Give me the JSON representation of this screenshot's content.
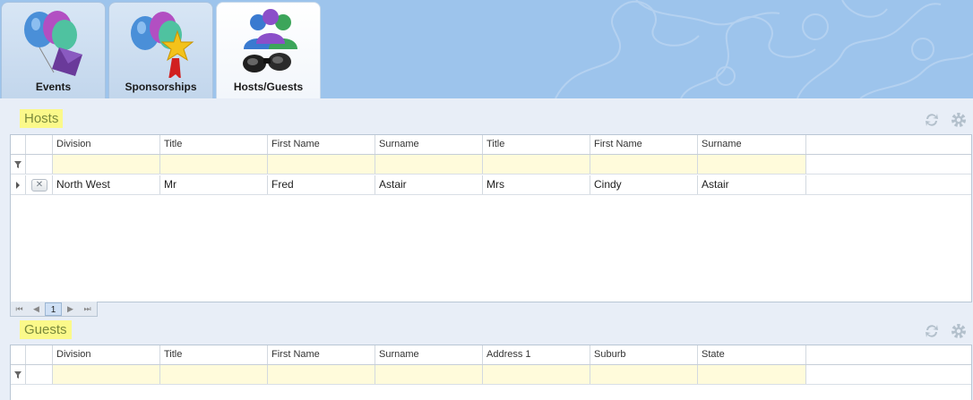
{
  "tabs": [
    {
      "label": "Events",
      "icon": "balloons-envelope-icon"
    },
    {
      "label": "Sponsorships",
      "icon": "balloons-award-icon"
    },
    {
      "label": "Hosts/Guests",
      "icon": "people-binoculars-icon",
      "active": true
    }
  ],
  "hosts": {
    "title": "Hosts",
    "columns": [
      "Division",
      "Title",
      "First Name",
      "Surname",
      "Title",
      "First Name",
      "Surname"
    ],
    "rows": [
      {
        "cells": [
          "North West",
          "Mr",
          "Fred",
          "Astair",
          "Mrs",
          "Cindy",
          "Astair"
        ]
      }
    ],
    "pager": {
      "first": "⏮",
      "prev": "◀",
      "page": "1",
      "next": "▶",
      "last": "⏭"
    }
  },
  "guests": {
    "title": "Guests",
    "columns": [
      "Division",
      "Title",
      "First Name",
      "Surname",
      "Address 1",
      "Suburb",
      "State"
    ]
  },
  "colors": {
    "accent": "#fbf98a",
    "filter_row": "#fffbdb",
    "topbar": "#9dc4ec"
  }
}
